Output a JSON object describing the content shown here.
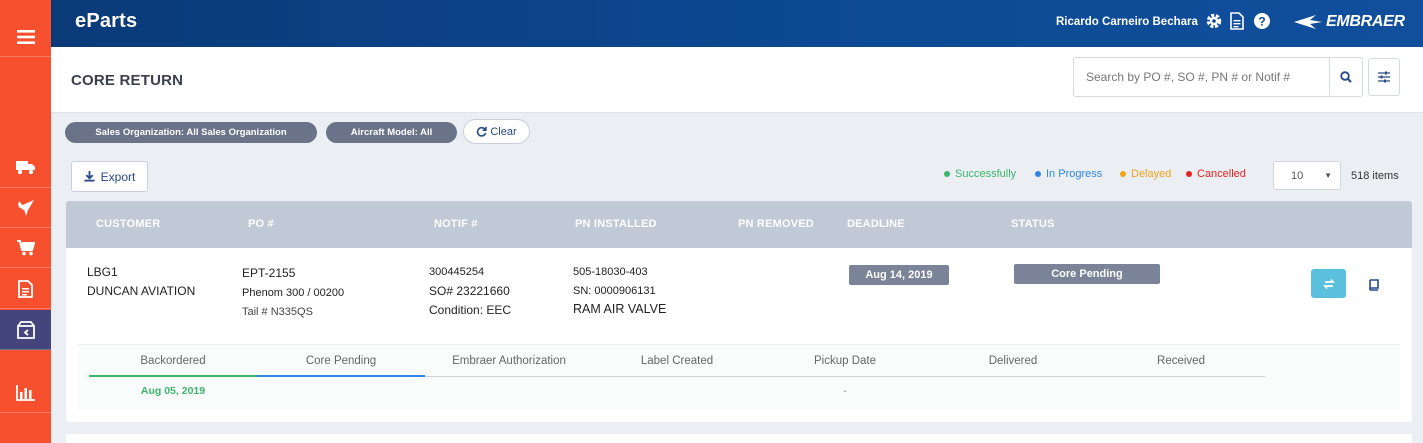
{
  "app": {
    "brand": "eParts",
    "user_name": "Ricardo Carneiro Bechara",
    "logo_text": "EMBRAER"
  },
  "sidebar": {
    "items": [
      {
        "icon": "hamburger-menu-icon"
      },
      {
        "icon": "truck-icon"
      },
      {
        "icon": "airplane-icon"
      },
      {
        "icon": "cart-icon"
      },
      {
        "icon": "document-icon"
      },
      {
        "icon": "return-box-icon",
        "active": true
      },
      {
        "icon": "bar-chart-icon"
      }
    ]
  },
  "page": {
    "title": "CORE RETURN"
  },
  "search": {
    "placeholder": "Search by PO #, SO #, PN # or Notif #"
  },
  "filters": {
    "sales_org": "Sales Organization: All Sales Organization",
    "aircraft_model": "Aircraft Model: All",
    "clear_label": "Clear"
  },
  "toolbar": {
    "export_label": "Export",
    "page_size": "10",
    "items_count": "518 items"
  },
  "legend": [
    {
      "label": "Successfully",
      "color": "#3cb56b"
    },
    {
      "label": "In Progress",
      "color": "#2f86e6"
    },
    {
      "label": "Delayed",
      "color": "#f0a21b"
    },
    {
      "label": "Cancelled",
      "color": "#e0251f"
    }
  ],
  "table": {
    "headers": [
      "CUSTOMER",
      "PO #",
      "NOTIF #",
      "PN INSTALLED",
      "PN REMOVED",
      "DEADLINE",
      "STATUS"
    ],
    "row": {
      "customer_code": "LBG1",
      "customer_name": "DUNCAN AVIATION",
      "po": "EPT-2155",
      "aircraft": "Phenom 300 / 00200",
      "tail": "Tail # N335QS",
      "notif": "300445254",
      "so": "SO# 23221660",
      "condition": "Condition: EEC",
      "pn_installed": "505-18030-403",
      "sn": "SN: 0000906131",
      "description": "RAM AIR VALVE",
      "deadline": "Aug 14, 2019",
      "status": "Core Pending"
    }
  },
  "tracker": {
    "steps": [
      "Backordered",
      "Core Pending",
      "Embraer Authorization",
      "Label Created",
      "Pickup Date",
      "Delivered",
      "Received"
    ],
    "backordered_date": "Aug 05, 2019",
    "pickup_date": "-",
    "colors": {
      "done": "#3cb56b",
      "current": "#2f86e6"
    }
  }
}
